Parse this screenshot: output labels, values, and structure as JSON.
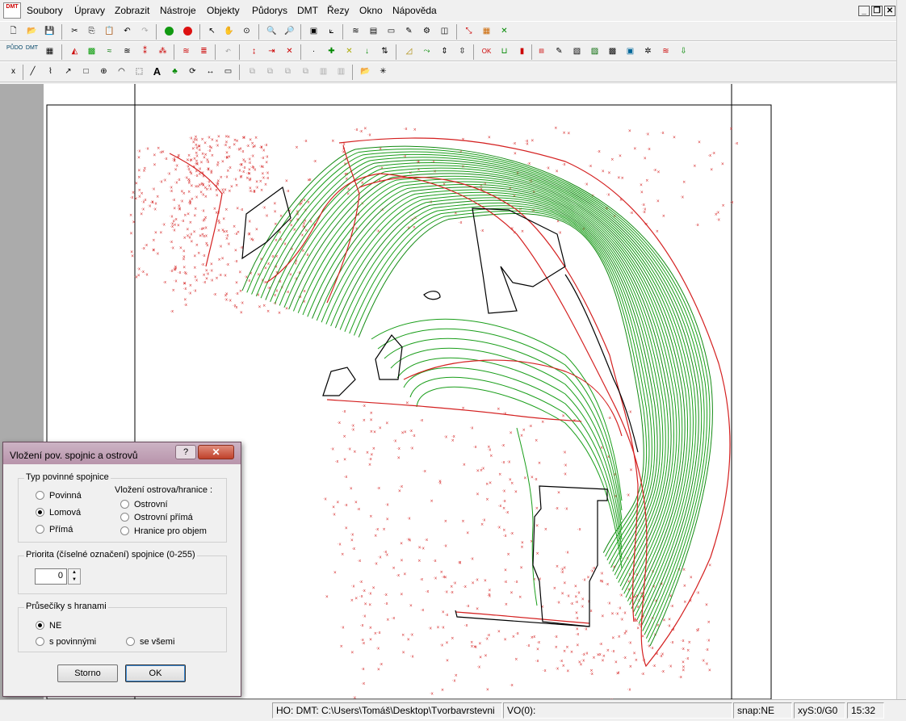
{
  "menu": {
    "app_icon_text": "DMT",
    "items": [
      "Soubory",
      "Úpravy",
      "Zobrazit",
      "Nástroje",
      "Objekty",
      "Půdorys",
      "DMT",
      "Řezy",
      "Okno",
      "Nápověda"
    ]
  },
  "toolbar": {
    "row2_labels": [
      "PŮDO",
      "DMT"
    ]
  },
  "dialog": {
    "title": "Vložení pov. spojnic a ostrovů",
    "help": "?",
    "close": "✕",
    "group_type": {
      "label": "Typ povinné spojnice",
      "options": [
        "Povinná",
        "Lomová",
        "Přímá"
      ],
      "selected": "Lomová"
    },
    "group_island": {
      "label": "Vložení ostrova/hranice :",
      "options": [
        "Ostrovní",
        "Ostrovní přímá",
        "Hranice pro objem"
      ]
    },
    "group_priority": {
      "label": "Priorita (číselné označení) spojnice (0-255)",
      "value": "0"
    },
    "group_intersect": {
      "label": "Průsečíky s hranami",
      "options": [
        "NE",
        "s povinnými",
        "se všemi"
      ],
      "selected": "NE"
    },
    "cancel_label": "Storno",
    "ok_label": "OK"
  },
  "status": {
    "path": "HO: DMT: C:\\Users\\Tomáš\\Desktop\\Tvorbavrstevni",
    "vo": "VO(0):",
    "snap": "snap:NE",
    "xys": "xyS:0/G0",
    "time": "15:32"
  },
  "colors": {
    "contour_green": "#1a9e1a",
    "break_red": "#d42020",
    "outline_black": "#000000",
    "dialog_title": "#c5a8bb"
  }
}
